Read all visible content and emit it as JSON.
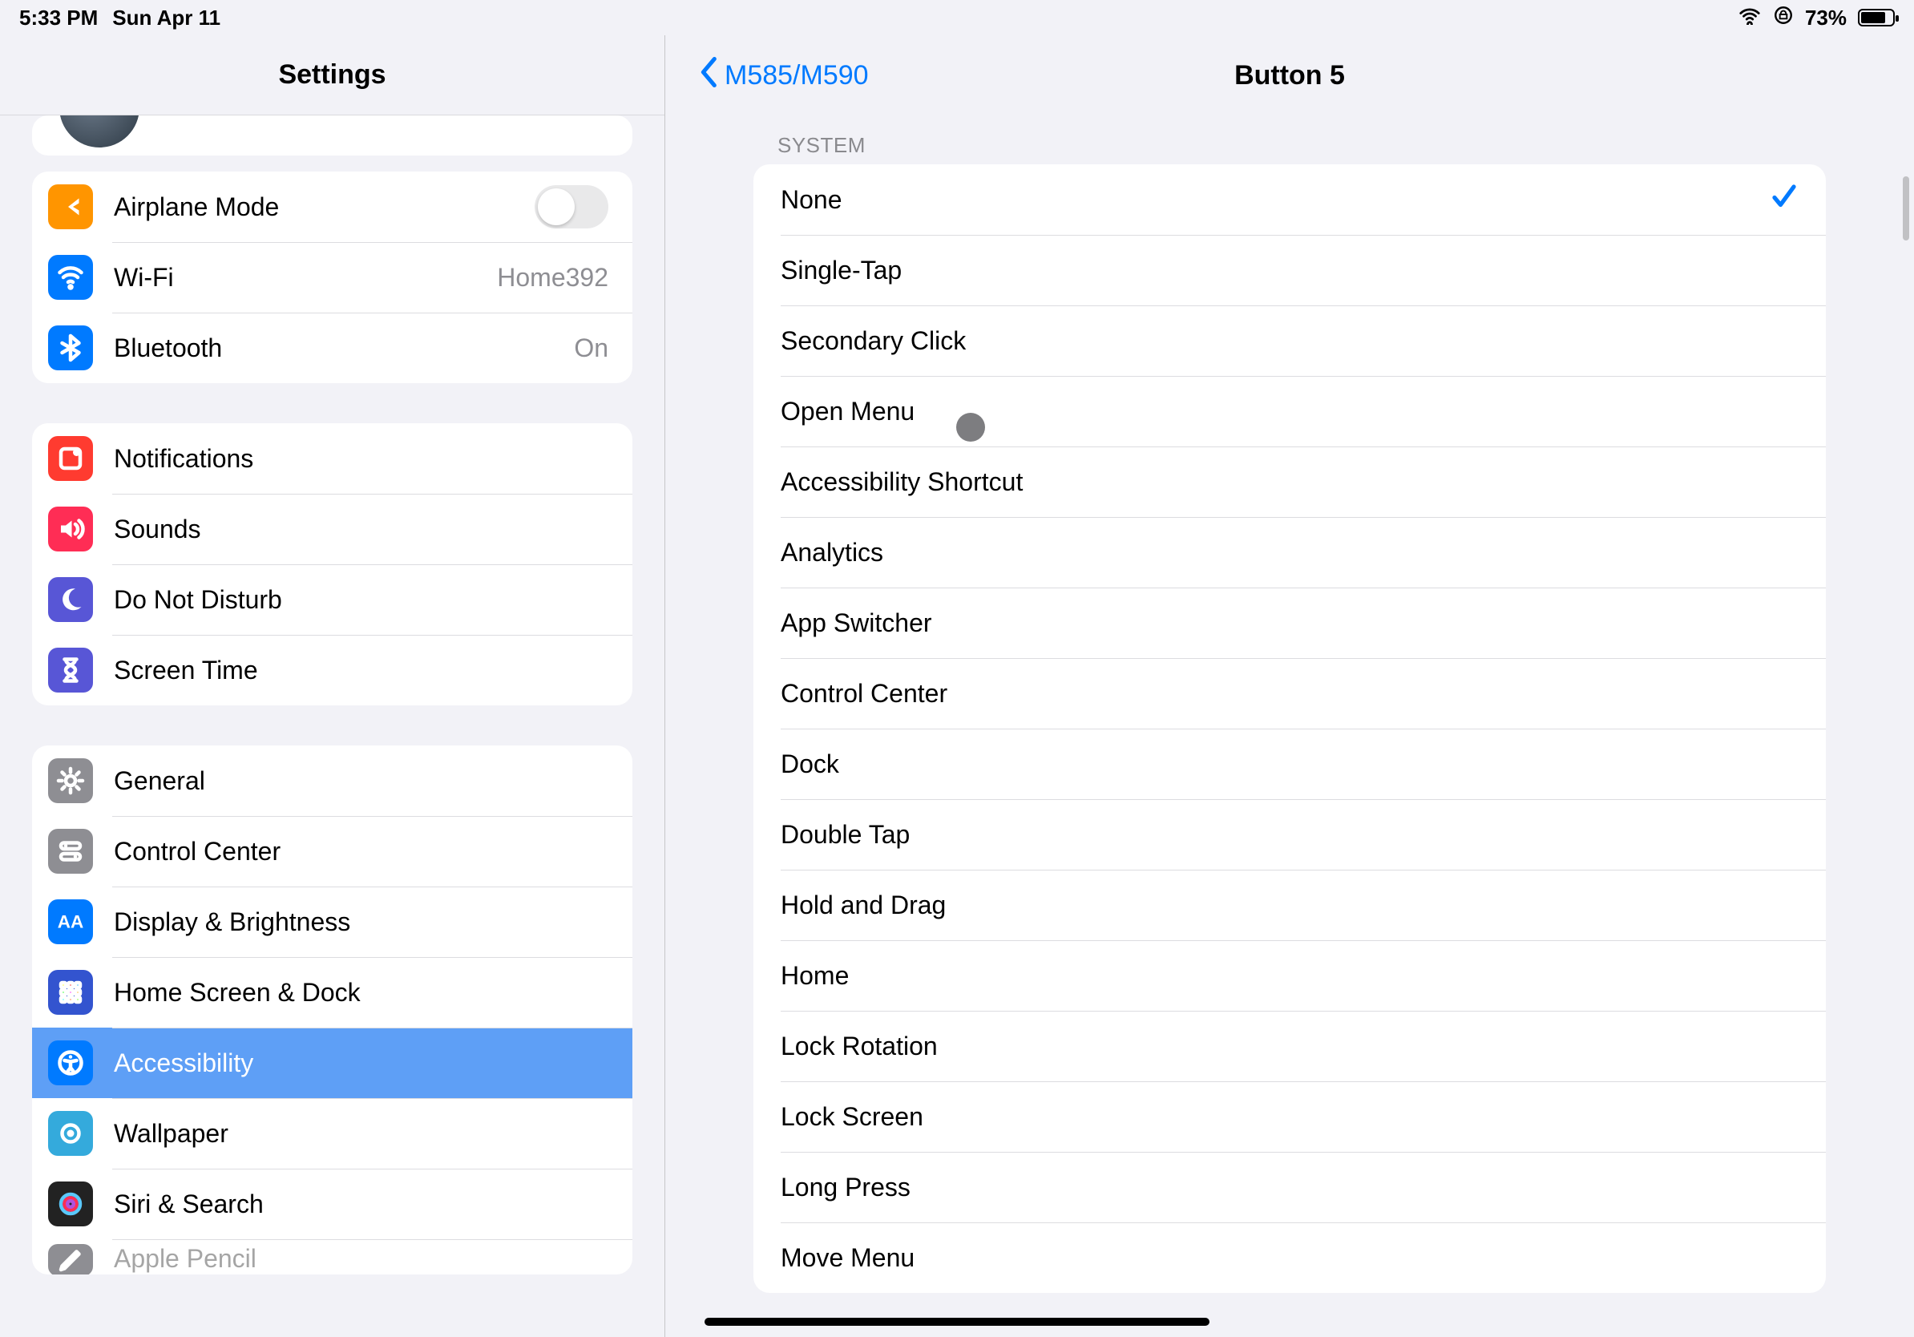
{
  "status": {
    "time": "5:33 PM",
    "date": "Sun Apr 11",
    "battery_pct": "73%"
  },
  "sidebar": {
    "title": "Settings",
    "g0_airplane": {
      "label": "Airplane Mode"
    },
    "g0_wifi": {
      "label": "Wi-Fi",
      "value": "Home392"
    },
    "g0_bluetooth": {
      "label": "Bluetooth",
      "value": "On"
    },
    "g1_notifications": {
      "label": "Notifications"
    },
    "g1_sounds": {
      "label": "Sounds"
    },
    "g1_dnd": {
      "label": "Do Not Disturb"
    },
    "g1_screentime": {
      "label": "Screen Time"
    },
    "g2_general": {
      "label": "General"
    },
    "g2_cc": {
      "label": "Control Center"
    },
    "g2_display": {
      "label": "Display & Brightness"
    },
    "g2_home": {
      "label": "Home Screen & Dock"
    },
    "g2_accessibility": {
      "label": "Accessibility"
    },
    "g2_wallpaper": {
      "label": "Wallpaper"
    },
    "g2_siri": {
      "label": "Siri & Search"
    },
    "g2_pencil": {
      "label": "Apple Pencil"
    }
  },
  "detail": {
    "back_label": "M585/M590",
    "title": "Button 5",
    "section_header": "SYSTEM",
    "options": {
      "o0": "None",
      "o1": "Single-Tap",
      "o2": "Secondary Click",
      "o3": "Open Menu",
      "o4": "Accessibility Shortcut",
      "o5": "Analytics",
      "o6": "App Switcher",
      "o7": "Control Center",
      "o8": "Dock",
      "o9": "Double Tap",
      "o10": "Hold and Drag",
      "o11": "Home",
      "o12": "Lock Rotation",
      "o13": "Lock Screen",
      "o14": "Long Press",
      "o15": "Move Menu"
    }
  }
}
